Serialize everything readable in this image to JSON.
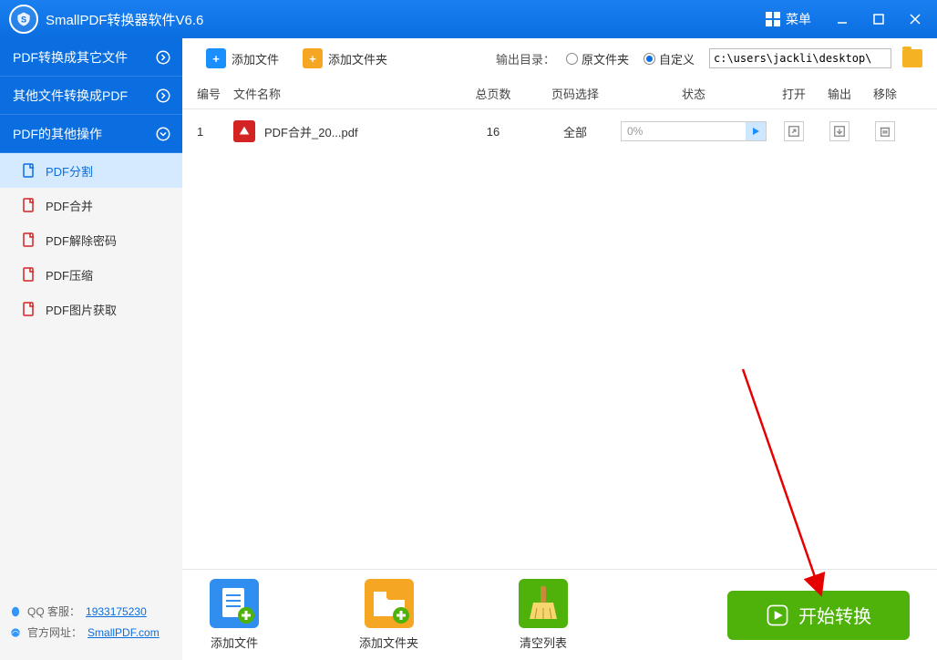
{
  "titlebar": {
    "title": "SmallPDF转换器软件V6.6",
    "menu": "菜单"
  },
  "sidebar": {
    "cats": [
      {
        "label": "PDF转换成其它文件"
      },
      {
        "label": "其他文件转换成PDF"
      },
      {
        "label": "PDF的其他操作"
      }
    ],
    "subs": [
      {
        "label": "PDF分割"
      },
      {
        "label": "PDF合并"
      },
      {
        "label": "PDF解除密码"
      },
      {
        "label": "PDF压缩"
      },
      {
        "label": "PDF图片获取"
      }
    ],
    "support": {
      "qq_label": "QQ 客服：",
      "qq": "1933175230",
      "site_label": "官方网址：",
      "site": "SmallPDF.com"
    }
  },
  "toolbar": {
    "add_file": "添加文件",
    "add_folder": "添加文件夹",
    "output_label": "输出目录：",
    "opt_original": "原文件夹",
    "opt_custom": "自定义",
    "path": "c:\\users\\jackli\\desktop\\"
  },
  "columns": {
    "no": "编号",
    "name": "文件名称",
    "pages": "总页数",
    "sel": "页码选择",
    "status": "状态",
    "open": "打开",
    "out": "输出",
    "del": "移除"
  },
  "rows": [
    {
      "no": "1",
      "name": "PDF合并_20...pdf",
      "pages": "16",
      "sel": "全部",
      "progress": "0%"
    }
  ],
  "bottom": {
    "add_file": "添加文件",
    "add_folder": "添加文件夹",
    "clear": "清空列表",
    "start": "开始转换"
  }
}
